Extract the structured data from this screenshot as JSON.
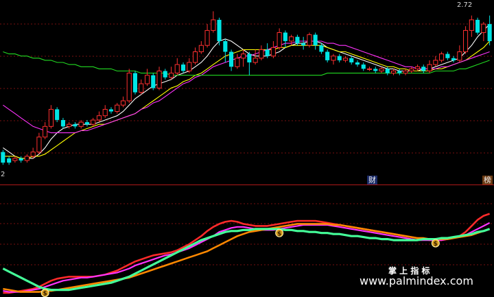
{
  "chart_data": [
    {
      "type": "candlestick",
      "ylim": [
        1.95,
        2.78
      ],
      "grid": true,
      "annotations": {
        "high_label": "2.72",
        "low_label": "2"
      },
      "candles": [
        [
          2.08,
          2.03,
          2.09,
          2.02
        ],
        [
          2.05,
          2.03,
          2.06,
          2.02
        ],
        [
          2.04,
          2.05,
          2.06,
          2.03
        ],
        [
          2.05,
          2.04,
          2.06,
          2.03
        ],
        [
          2.04,
          2.06,
          2.07,
          2.03
        ],
        [
          2.06,
          2.08,
          2.1,
          2.05
        ],
        [
          2.08,
          2.15,
          2.17,
          2.07
        ],
        [
          2.15,
          2.2,
          2.22,
          2.14
        ],
        [
          2.2,
          2.28,
          2.3,
          2.19
        ],
        [
          2.28,
          2.23,
          2.29,
          2.22
        ],
        [
          2.23,
          2.2,
          2.24,
          2.19
        ],
        [
          2.2,
          2.21,
          2.22,
          2.19
        ],
        [
          2.21,
          2.2,
          2.22,
          2.19
        ],
        [
          2.2,
          2.22,
          2.23,
          2.19
        ],
        [
          2.22,
          2.21,
          2.23,
          2.2
        ],
        [
          2.21,
          2.23,
          2.24,
          2.2
        ],
        [
          2.23,
          2.25,
          2.27,
          2.22
        ],
        [
          2.25,
          2.28,
          2.3,
          2.24
        ],
        [
          2.28,
          2.27,
          2.29,
          2.26
        ],
        [
          2.27,
          2.3,
          2.31,
          2.26
        ],
        [
          2.3,
          2.32,
          2.34,
          2.29
        ],
        [
          2.32,
          2.45,
          2.47,
          2.31
        ],
        [
          2.45,
          2.36,
          2.46,
          2.35
        ],
        [
          2.36,
          2.4,
          2.42,
          2.35
        ],
        [
          2.4,
          2.44,
          2.47,
          2.39
        ],
        [
          2.44,
          2.38,
          2.45,
          2.37
        ],
        [
          2.38,
          2.46,
          2.48,
          2.37
        ],
        [
          2.46,
          2.43,
          2.47,
          2.42
        ],
        [
          2.43,
          2.45,
          2.48,
          2.42
        ],
        [
          2.45,
          2.49,
          2.52,
          2.44
        ],
        [
          2.49,
          2.46,
          2.5,
          2.45
        ],
        [
          2.46,
          2.5,
          2.52,
          2.45
        ],
        [
          2.5,
          2.55,
          2.57,
          2.49
        ],
        [
          2.55,
          2.58,
          2.6,
          2.54
        ],
        [
          2.58,
          2.65,
          2.68,
          2.57
        ],
        [
          2.65,
          2.7,
          2.74,
          2.64
        ],
        [
          2.7,
          2.6,
          2.71,
          2.58
        ],
        [
          2.6,
          2.55,
          2.61,
          2.5
        ],
        [
          2.55,
          2.48,
          2.56,
          2.46
        ],
        [
          2.48,
          2.52,
          2.54,
          2.47
        ],
        [
          2.52,
          2.54,
          2.56,
          2.48
        ],
        [
          2.54,
          2.5,
          2.55,
          2.44
        ],
        [
          2.5,
          2.52,
          2.56,
          2.49
        ],
        [
          2.52,
          2.56,
          2.58,
          2.51
        ],
        [
          2.56,
          2.53,
          2.59,
          2.52
        ],
        [
          2.53,
          2.57,
          2.6,
          2.52
        ],
        [
          2.57,
          2.64,
          2.66,
          2.56
        ],
        [
          2.64,
          2.6,
          2.65,
          2.57
        ],
        [
          2.6,
          2.62,
          2.63,
          2.58
        ],
        [
          2.62,
          2.59,
          2.63,
          2.58
        ],
        [
          2.59,
          2.58,
          2.62,
          2.56
        ],
        [
          2.58,
          2.63,
          2.64,
          2.57
        ],
        [
          2.63,
          2.58,
          2.64,
          2.56
        ],
        [
          2.58,
          2.55,
          2.59,
          2.54
        ],
        [
          2.55,
          2.51,
          2.56,
          2.5
        ],
        [
          2.51,
          2.53,
          2.54,
          2.49
        ],
        [
          2.53,
          2.51,
          2.54,
          2.5
        ],
        [
          2.51,
          2.52,
          2.53,
          2.5
        ],
        [
          2.52,
          2.5,
          2.53,
          2.49
        ],
        [
          2.5,
          2.49,
          2.51,
          2.48
        ],
        [
          2.49,
          2.47,
          2.5,
          2.46
        ],
        [
          2.47,
          2.47,
          2.48,
          2.46
        ],
        [
          2.47,
          2.46,
          2.48,
          2.45
        ],
        [
          2.46,
          2.47,
          2.48,
          2.45
        ],
        [
          2.47,
          2.45,
          2.48,
          2.44
        ],
        [
          2.45,
          2.46,
          2.47,
          2.44
        ],
        [
          2.46,
          2.45,
          2.47,
          2.44
        ],
        [
          2.45,
          2.46,
          2.47,
          2.44
        ],
        [
          2.46,
          2.47,
          2.48,
          2.45
        ],
        [
          2.47,
          2.48,
          2.49,
          2.46
        ],
        [
          2.48,
          2.46,
          2.49,
          2.45
        ],
        [
          2.46,
          2.49,
          2.51,
          2.45
        ],
        [
          2.49,
          2.51,
          2.53,
          2.48
        ],
        [
          2.51,
          2.54,
          2.55,
          2.5
        ],
        [
          2.54,
          2.52,
          2.55,
          2.51
        ],
        [
          2.52,
          2.51,
          2.53,
          2.5
        ],
        [
          2.51,
          2.55,
          2.58,
          2.5
        ],
        [
          2.55,
          2.65,
          2.67,
          2.54
        ],
        [
          2.65,
          2.7,
          2.72,
          2.62
        ],
        [
          2.7,
          2.64,
          2.71,
          2.63
        ],
        [
          2.64,
          2.68,
          2.69,
          2.6
        ],
        [
          2.68,
          2.6,
          2.72,
          2.58
        ]
      ],
      "ma_lines": [
        {
          "color": "#ffffff",
          "values": [
            2.1,
            2.08,
            2.06,
            2.05,
            2.05,
            2.05,
            2.07,
            2.1,
            2.14,
            2.17,
            2.19,
            2.2,
            2.21,
            2.21,
            2.21,
            2.21,
            2.22,
            2.23,
            2.24,
            2.25,
            2.27,
            2.3,
            2.33,
            2.35,
            2.37,
            2.39,
            2.4,
            2.41,
            2.42,
            2.44,
            2.45,
            2.46,
            2.48,
            2.5,
            2.53,
            2.57,
            2.6,
            2.61,
            2.6,
            2.58,
            2.56,
            2.54,
            2.53,
            2.53,
            2.53,
            2.54,
            2.55,
            2.57,
            2.58,
            2.59,
            2.59,
            2.6,
            2.6,
            2.59,
            2.57,
            2.56,
            2.55,
            2.54,
            2.53,
            2.52,
            2.51,
            2.5,
            2.49,
            2.48,
            2.47,
            2.47,
            2.46,
            2.46,
            2.46,
            2.46,
            2.47,
            2.47,
            2.48,
            2.49,
            2.5,
            2.51,
            2.52,
            2.55,
            2.58,
            2.62,
            2.65,
            2.68
          ]
        },
        {
          "color": "#ffff00",
          "values": [
            2.06,
            2.06,
            2.06,
            2.05,
            2.05,
            2.06,
            2.06,
            2.07,
            2.09,
            2.11,
            2.13,
            2.15,
            2.17,
            2.18,
            2.19,
            2.2,
            2.21,
            2.21,
            2.22,
            2.23,
            2.24,
            2.25,
            2.26,
            2.28,
            2.3,
            2.32,
            2.34,
            2.36,
            2.38,
            2.39,
            2.41,
            2.42,
            2.44,
            2.45,
            2.47,
            2.49,
            2.51,
            2.53,
            2.54,
            2.55,
            2.56,
            2.56,
            2.56,
            2.56,
            2.56,
            2.56,
            2.57,
            2.57,
            2.58,
            2.58,
            2.58,
            2.58,
            2.58,
            2.58,
            2.57,
            2.56,
            2.55,
            2.55,
            2.54,
            2.53,
            2.52,
            2.51,
            2.5,
            2.49,
            2.48,
            2.48,
            2.47,
            2.47,
            2.46,
            2.46,
            2.46,
            2.46,
            2.47,
            2.47,
            2.48,
            2.49,
            2.5,
            2.51,
            2.53,
            2.55,
            2.57,
            2.6
          ]
        },
        {
          "color": "#ff33ff",
          "values": [
            2.3,
            2.28,
            2.26,
            2.24,
            2.22,
            2.2,
            2.19,
            2.18,
            2.17,
            2.17,
            2.17,
            2.17,
            2.17,
            2.18,
            2.18,
            2.19,
            2.2,
            2.21,
            2.22,
            2.23,
            2.24,
            2.25,
            2.26,
            2.28,
            2.29,
            2.31,
            2.32,
            2.34,
            2.36,
            2.38,
            2.4,
            2.41,
            2.43,
            2.44,
            2.46,
            2.48,
            2.49,
            2.5,
            2.51,
            2.52,
            2.53,
            2.53,
            2.54,
            2.55,
            2.56,
            2.57,
            2.58,
            2.59,
            2.59,
            2.6,
            2.6,
            2.6,
            2.6,
            2.6,
            2.59,
            2.59,
            2.58,
            2.58,
            2.57,
            2.56,
            2.55,
            2.54,
            2.53,
            2.52,
            2.51,
            2.5,
            2.49,
            2.48,
            2.48,
            2.47,
            2.47,
            2.47,
            2.47,
            2.48,
            2.48,
            2.49,
            2.5,
            2.51,
            2.52,
            2.53,
            2.54,
            2.55
          ]
        },
        {
          "color": "#22dd22",
          "values": [
            2.55,
            2.54,
            2.54,
            2.53,
            2.53,
            2.52,
            2.52,
            2.51,
            2.51,
            2.5,
            2.5,
            2.49,
            2.49,
            2.48,
            2.48,
            2.48,
            2.47,
            2.47,
            2.47,
            2.46,
            2.46,
            2.46,
            2.46,
            2.45,
            2.45,
            2.45,
            2.45,
            2.45,
            2.44,
            2.44,
            2.44,
            2.44,
            2.44,
            2.44,
            2.44,
            2.44,
            2.44,
            2.44,
            2.44,
            2.44,
            2.44,
            2.44,
            2.44,
            2.44,
            2.44,
            2.44,
            2.44,
            2.44,
            2.44,
            2.44,
            2.44,
            2.44,
            2.44,
            2.44,
            2.45,
            2.45,
            2.45,
            2.45,
            2.45,
            2.45,
            2.45,
            2.45,
            2.45,
            2.45,
            2.45,
            2.45,
            2.45,
            2.45,
            2.45,
            2.45,
            2.45,
            2.45,
            2.46,
            2.46,
            2.46,
            2.46,
            2.47,
            2.47,
            2.48,
            2.49,
            2.5,
            2.51
          ]
        }
      ]
    },
    {
      "type": "line",
      "ylim": [
        0,
        100
      ],
      "grid": true,
      "series": [
        {
          "color": "#ff2a2a",
          "values": [
            2,
            2,
            3,
            4,
            5,
            6,
            8,
            11,
            14,
            16,
            17,
            18,
            18,
            18,
            18,
            18,
            19,
            20,
            22,
            24,
            27,
            30,
            33,
            35,
            37,
            39,
            40,
            41,
            42,
            44,
            47,
            50,
            54,
            58,
            63,
            67,
            70,
            72,
            73,
            72,
            70,
            69,
            68,
            68,
            68,
            69,
            70,
            71,
            72,
            73,
            73,
            73,
            73,
            72,
            71,
            70,
            69,
            68,
            67,
            66,
            65,
            64,
            63,
            62,
            61,
            60,
            59,
            58,
            57,
            56,
            55,
            54,
            54,
            54,
            55,
            56,
            58,
            62,
            68,
            74,
            78,
            80
          ]
        },
        {
          "color": "#ff33ff",
          "values": [
            4,
            3,
            3,
            3,
            4,
            5,
            6,
            8,
            10,
            12,
            14,
            15,
            16,
            17,
            17,
            18,
            19,
            20,
            21,
            22,
            24,
            26,
            29,
            31,
            33,
            35,
            37,
            39,
            40,
            42,
            44,
            46,
            49,
            52,
            55,
            58,
            62,
            64,
            66,
            67,
            67,
            66,
            65,
            64,
            64,
            64,
            65,
            66,
            67,
            68,
            69,
            69,
            69,
            69,
            69,
            68,
            67,
            66,
            65,
            64,
            63,
            62,
            61,
            60,
            59,
            58,
            57,
            56,
            55,
            54,
            54,
            54,
            54,
            54,
            55,
            56,
            57,
            59,
            62,
            65,
            68,
            71
          ]
        },
        {
          "color": "#ff8800",
          "values": [
            6,
            5,
            4,
            3,
            3,
            3,
            3,
            4,
            4,
            5,
            6,
            7,
            8,
            9,
            10,
            11,
            12,
            13,
            14,
            15,
            16,
            17,
            19,
            21,
            23,
            25,
            27,
            29,
            31,
            33,
            35,
            37,
            39,
            41,
            43,
            46,
            49,
            52,
            55,
            58,
            60,
            62,
            63,
            64,
            65,
            66,
            67,
            68,
            69,
            70,
            70,
            70,
            70,
            70,
            70,
            69,
            69,
            68,
            67,
            66,
            65,
            64,
            63,
            62,
            61,
            60,
            59,
            58,
            57,
            56,
            56,
            55,
            55,
            55,
            55,
            56,
            57,
            58,
            59,
            61,
            63,
            65
          ]
        },
        {
          "color": "#44ff99",
          "values": [
            26,
            23,
            20,
            17,
            14,
            11,
            8,
            6,
            5,
            5,
            5,
            5,
            6,
            7,
            8,
            9,
            10,
            11,
            12,
            14,
            16,
            18,
            21,
            24,
            27,
            30,
            33,
            36,
            39,
            42,
            45,
            48,
            51,
            54,
            56,
            58,
            60,
            62,
            63,
            63,
            64,
            64,
            65,
            65,
            65,
            65,
            65,
            64,
            64,
            63,
            63,
            62,
            62,
            61,
            61,
            60,
            60,
            59,
            58,
            58,
            57,
            56,
            56,
            55,
            55,
            54,
            54,
            54,
            54,
            54,
            55,
            55,
            55,
            56,
            56,
            57,
            58,
            59,
            60,
            62,
            63,
            65
          ]
        }
      ],
      "markers": [
        {
          "symbol": "$",
          "x": 7
        },
        {
          "symbol": "$",
          "x": 46
        },
        {
          "symbol": "$",
          "x": 72
        }
      ]
    }
  ],
  "panel_badges": {
    "left": "财",
    "right": "榜"
  },
  "watermark": {
    "title": "掌 上 指 标",
    "url": "www.palmindex.com"
  }
}
